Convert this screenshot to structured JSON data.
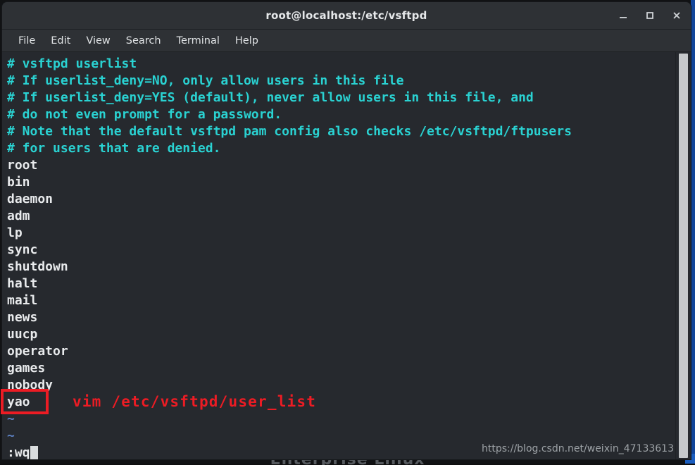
{
  "window": {
    "title": "root@localhost:/etc/vsftpd",
    "controls": [
      {
        "name": "minimize-button",
        "label": "–"
      },
      {
        "name": "maximize-button",
        "label": "□"
      },
      {
        "name": "close-button",
        "label": "✕"
      }
    ]
  },
  "menubar": {
    "items": [
      {
        "label": "File"
      },
      {
        "label": "Edit"
      },
      {
        "label": "View"
      },
      {
        "label": "Search"
      },
      {
        "label": "Terminal"
      },
      {
        "label": "Help"
      }
    ]
  },
  "terminal": {
    "comments": [
      "# vsftpd userlist",
      "# If userlist_deny=NO, only allow users in this file",
      "# If userlist_deny=YES (default), never allow users in this file, and",
      "# do not even prompt for a password.",
      "# Note that the default vsftpd pam config also checks /etc/vsftpd/ftpusers",
      "# for users that are denied."
    ],
    "users": [
      "root",
      "bin",
      "daemon",
      "adm",
      "lp",
      "sync",
      "shutdown",
      "halt",
      "mail",
      "news",
      "uucp",
      "operator",
      "games",
      "nobody",
      "yao"
    ],
    "empty_markers": [
      "~",
      "~"
    ],
    "status_line": ":wq",
    "colors": {
      "comment": "#2ad2d2",
      "text": "#e8eaec",
      "tilde": "#5c7fbf",
      "background": "#26292e"
    }
  },
  "annotations": {
    "command": "vim /etc/vsftpd/user_list",
    "highlight_target": "yao",
    "color": "#ec1c24"
  },
  "watermark": {
    "text": "https://blog.csdn.net/weixin_47133613"
  },
  "desktop": {
    "wallpaper_text": "Enterprise Linux",
    "accent_color": "#11459a"
  }
}
